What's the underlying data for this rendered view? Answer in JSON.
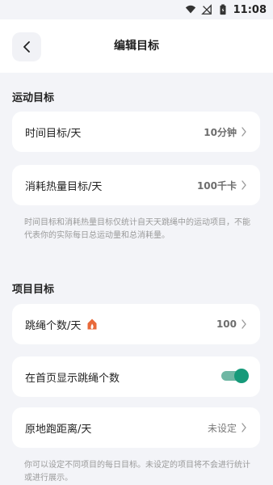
{
  "status_bar": {
    "time": "11:08"
  },
  "header": {
    "title": "编辑目标"
  },
  "exercise_goals": {
    "section_title": "运动目标",
    "time_goal": {
      "label": "时间目标/天",
      "value": "10分钟"
    },
    "calorie_goal": {
      "label": "消耗热量目标/天",
      "value": "100千卡"
    },
    "note": "时间目标和消耗热量目标仅统计自天天跳绳中的运动项目，不能代表你的实际每日总运动量和总消耗量。"
  },
  "item_goals": {
    "section_title": "项目目标",
    "jump_count": {
      "label": "跳绳个数/天",
      "value": "100",
      "icon": "flame-icon"
    },
    "show_on_home": {
      "label": "在首页显示跳绳个数",
      "enabled": true
    },
    "run_in_place": {
      "label": "原地跑距离/天",
      "value": "未设定"
    },
    "note": "你可以设定不同项目的每日目标。未设定的项目将不会进行统计或进行展示。"
  },
  "colors": {
    "accent": "#169a7a",
    "flame": "#e8693a",
    "background": "#f3f4f8"
  }
}
